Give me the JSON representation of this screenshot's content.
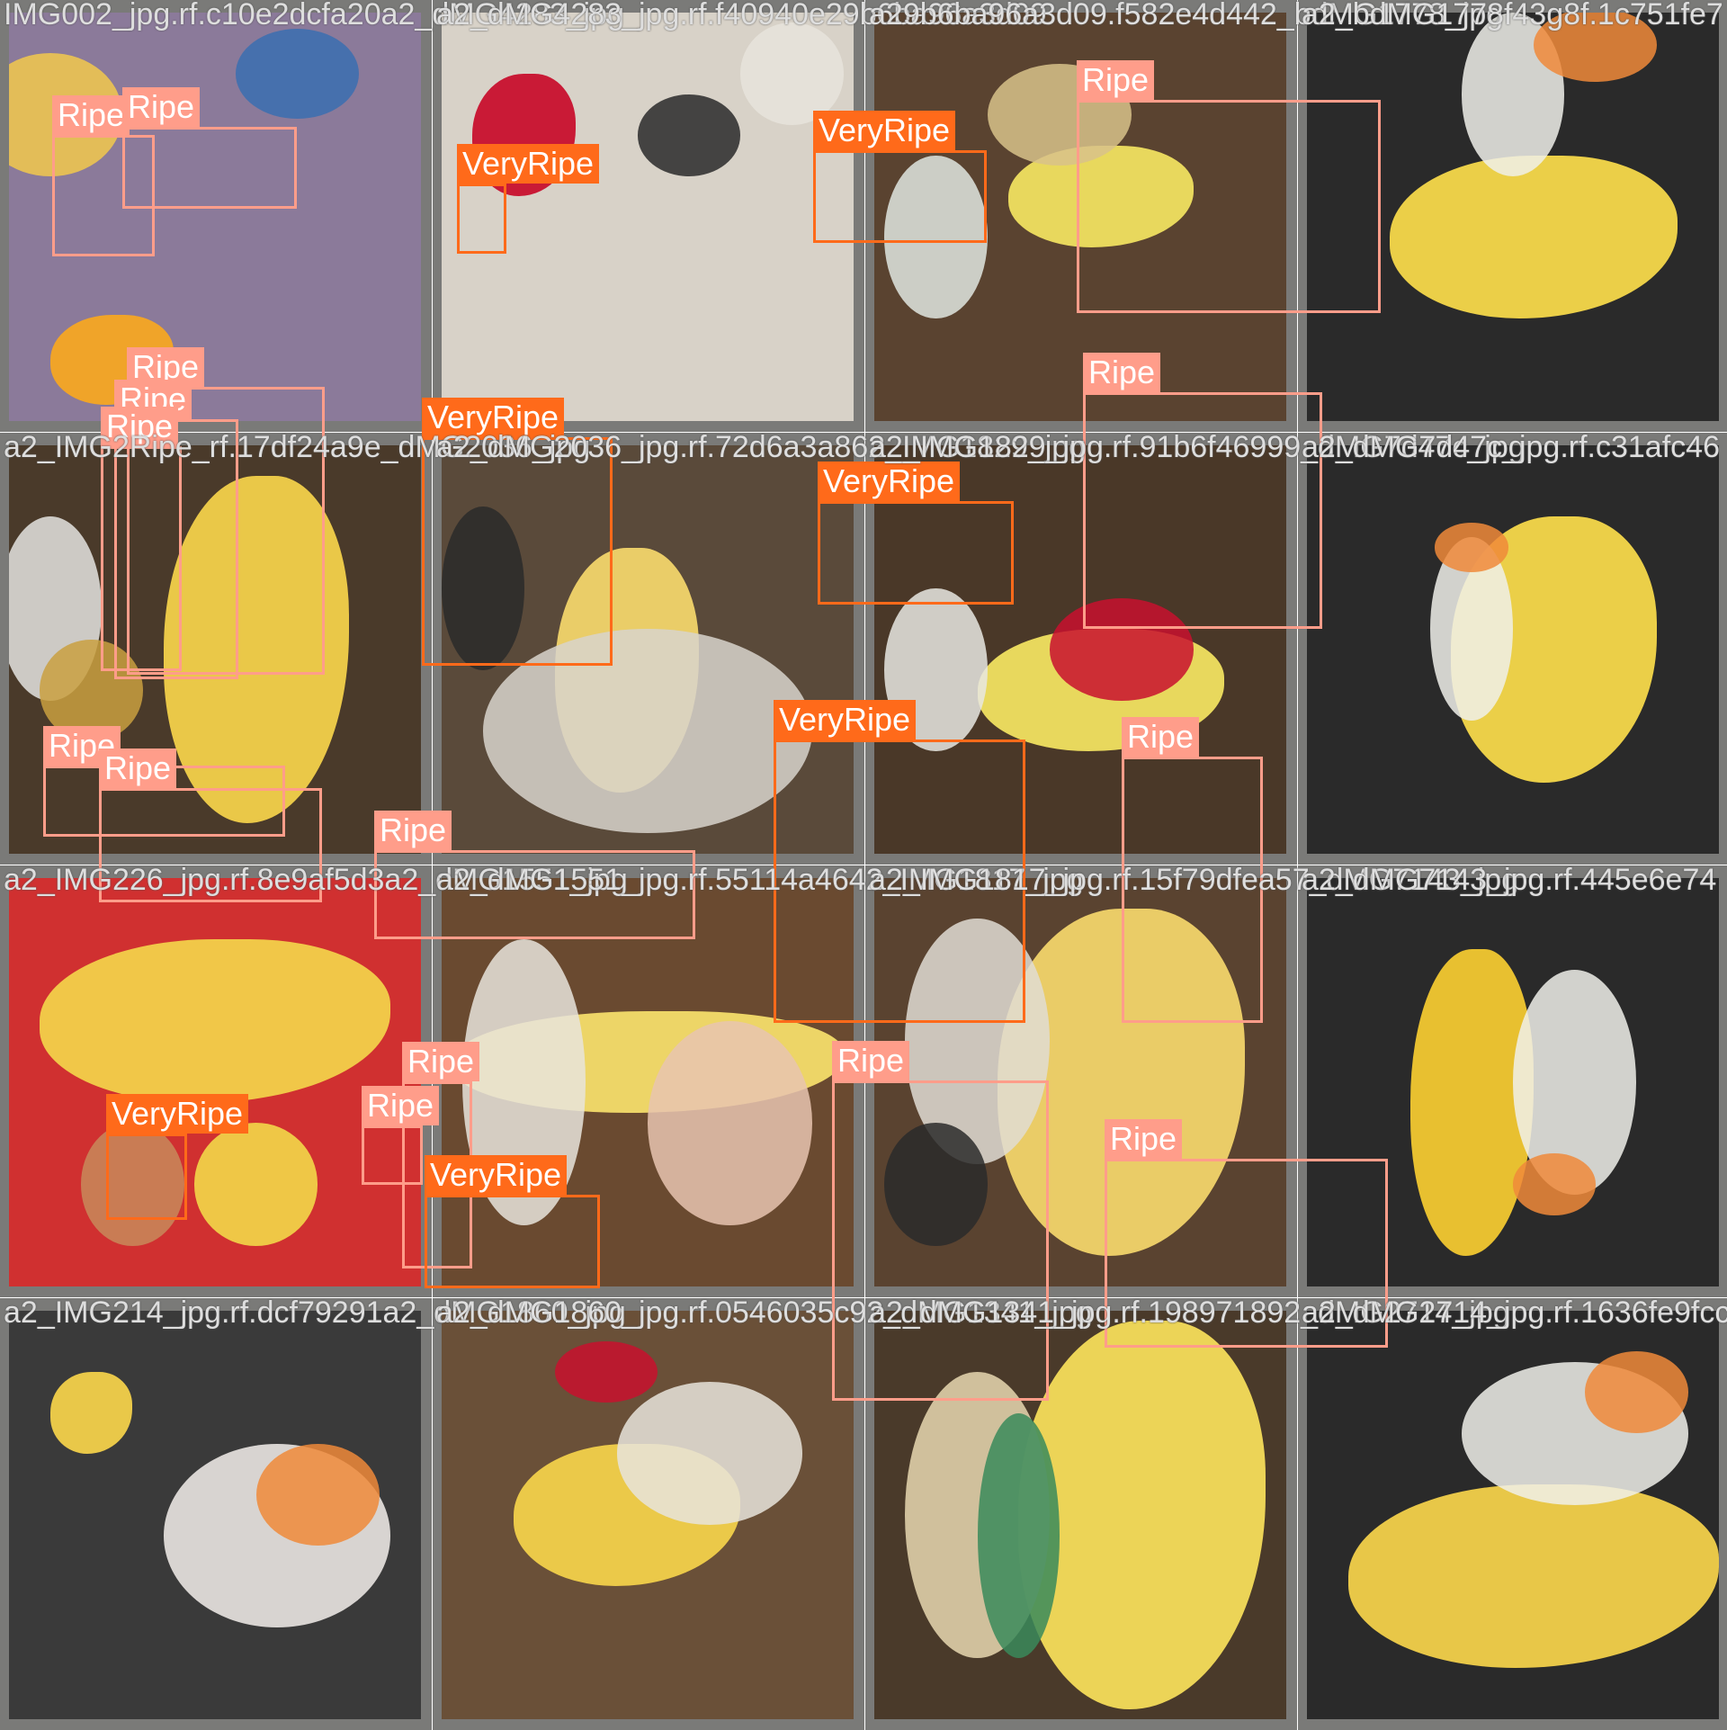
{
  "grid": {
    "rows": 4,
    "cols": 4
  },
  "colors": {
    "ripe": "#ff9d8a",
    "very_ripe": "#ff6a1a",
    "frame": "#7a7a78",
    "filename_text": "#dedede"
  },
  "tiles": [
    {
      "filename": "IMG002_jpg.rf.c10e2dcfa20a2_dMG4283_jpg",
      "scene": [
        "#8b7a9a",
        "#f5a623",
        "#f2c94c",
        "#3a6fb0"
      ],
      "boxes": [
        {
          "label": "Ripe",
          "class": "ripe"
        },
        {
          "label": "Ripe",
          "class": "ripe"
        }
      ]
    },
    {
      "filename": "a2_dMG4283_jpg.rf.f40940e29b6ba96a3d09",
      "scene": [
        "#d8d2c8",
        "#c8102e",
        "#2a2a2a",
        "#e8e4dc"
      ],
      "boxes": [
        {
          "label": "VeryRipe",
          "class": "very"
        }
      ]
    },
    {
      "filename": "a29b6ba96a3d09.f582e4d442_bdMG1778_jpg",
      "scene": [
        "#5a4330",
        "#f0e060",
        "#e0e6e0",
        "#d8c28a"
      ],
      "boxes": [
        {
          "label": "VeryRipe",
          "class": "very"
        }
      ]
    },
    {
      "filename": "a2_bdMG1778f43g8f.1c751fe7",
      "scene": [
        "#2a2a2a",
        "#f5d84a",
        "#f0f0ea",
        "#f08a3a"
      ],
      "boxes": [
        {
          "label": "Ripe",
          "class": "ripe"
        }
      ]
    },
    {
      "filename": "a2_IMG2Ripe_rf.17df24a9e_dMG2036_jpg",
      "scene": [
        "#4a3a2a",
        "#f2d04a",
        "#e4e4e0",
        "#c9a040"
      ],
      "boxes": [
        {
          "label": "Ripe",
          "class": "ripe"
        },
        {
          "label": "Ripe",
          "class": "ripe"
        },
        {
          "label": "Ripe",
          "class": "ripe"
        }
      ]
    },
    {
      "filename": "a2_dMG2036_jpg.rf.72d6a3a862_IMG1829_jpg",
      "scene": [
        "#5a4a3a",
        "#f2d46a",
        "#d8d4cc",
        "#2a2a2a"
      ],
      "boxes": [
        {
          "label": "VeryRipe",
          "class": "very"
        }
      ]
    },
    {
      "filename": "a2_IMG1829_jpg.rf.91b6f46999_dMG7d47c_jpg",
      "scene": [
        "#4a3828",
        "#f0e060",
        "#e8e8e2",
        "#c8102e"
      ],
      "boxes": [
        {
          "label": "VeryRipe",
          "class": "very"
        }
      ]
    },
    {
      "filename": "a2_dMG7d47c_jpg.rf.c31afc46",
      "scene": [
        "#2a2a2a",
        "#f5d84a",
        "#f0f0ea",
        "#f08a3a"
      ],
      "boxes": [
        {
          "label": "Ripe",
          "class": "ripe"
        }
      ]
    },
    {
      "filename": "a2_IMG226_jpg.rf.8e9af5d3a2_dMG1551_jpg",
      "scene": [
        "#d03030",
        "#f2d04a",
        "#f4e24a",
        "#c88a5a"
      ],
      "boxes": [
        {
          "label": "Ripe",
          "class": "ripe"
        },
        {
          "label": "Ripe",
          "class": "ripe"
        }
      ]
    },
    {
      "filename": "a2_dMG1551_jpg.rf.55114a4642_IMG1817_jpg",
      "scene": [
        "#6a4a30",
        "#f4dc6a",
        "#e8c4b0",
        "#e8e4dc"
      ],
      "boxes": [
        {
          "label": "Ripe",
          "class": "ripe"
        }
      ]
    },
    {
      "filename": "a2_IMG1817_jpg.rf.15f79dfea57_dMG7143_jpg",
      "scene": [
        "#5a4330",
        "#f2d46a",
        "#e0dcd4",
        "#2a2a2a"
      ],
      "boxes": [
        {
          "label": "VeryRipe",
          "class": "very"
        }
      ]
    },
    {
      "filename": "a2_dMG7143_jpg.rf.445e6e74",
      "scene": [
        "#2a2a2a",
        "#f2c830",
        "#f0f0ea",
        "#f08a3a"
      ],
      "boxes": [
        {
          "label": "Ripe",
          "class": "ripe"
        }
      ]
    },
    {
      "filename": "a2_IMG214_jpg.rf.dcf79291a2_dMG1860_jpg",
      "scene": [
        "#3a3a3a",
        "#f2d04a",
        "#f4f0ec",
        "#f08a3a"
      ],
      "boxes": [
        {
          "label": "VeryRipe",
          "class": "very"
        }
      ]
    },
    {
      "filename": "a2_dMG1860_jpg.rf.0546035c92_dMG1341_jpg",
      "scene": [
        "#6a5038",
        "#f2d04a",
        "#e8e4dc",
        "#c8102e"
      ],
      "boxes": [
        {
          "label": "Ripe",
          "class": "ripe"
        },
        {
          "label": "Ripe",
          "class": "ripe"
        },
        {
          "label": "VeryRipe",
          "class": "very"
        }
      ]
    },
    {
      "filename": "a2_dMG1341_jpg.rf.198971892_dMG2714_jpg",
      "scene": [
        "#4a3a2a",
        "#f4dc5a",
        "#e8d8b0",
        "#3a8a5a"
      ],
      "boxes": [
        {
          "label": "Ripe",
          "class": "ripe"
        }
      ]
    },
    {
      "filename": "a2_dMG2714_jpg.rf.1636fe9fcc",
      "scene": [
        "#2a2a2a",
        "#f2d04a",
        "#f0f0ea",
        "#f08a3a"
      ],
      "boxes": [
        {
          "label": "Ripe",
          "class": "ripe"
        }
      ]
    }
  ]
}
